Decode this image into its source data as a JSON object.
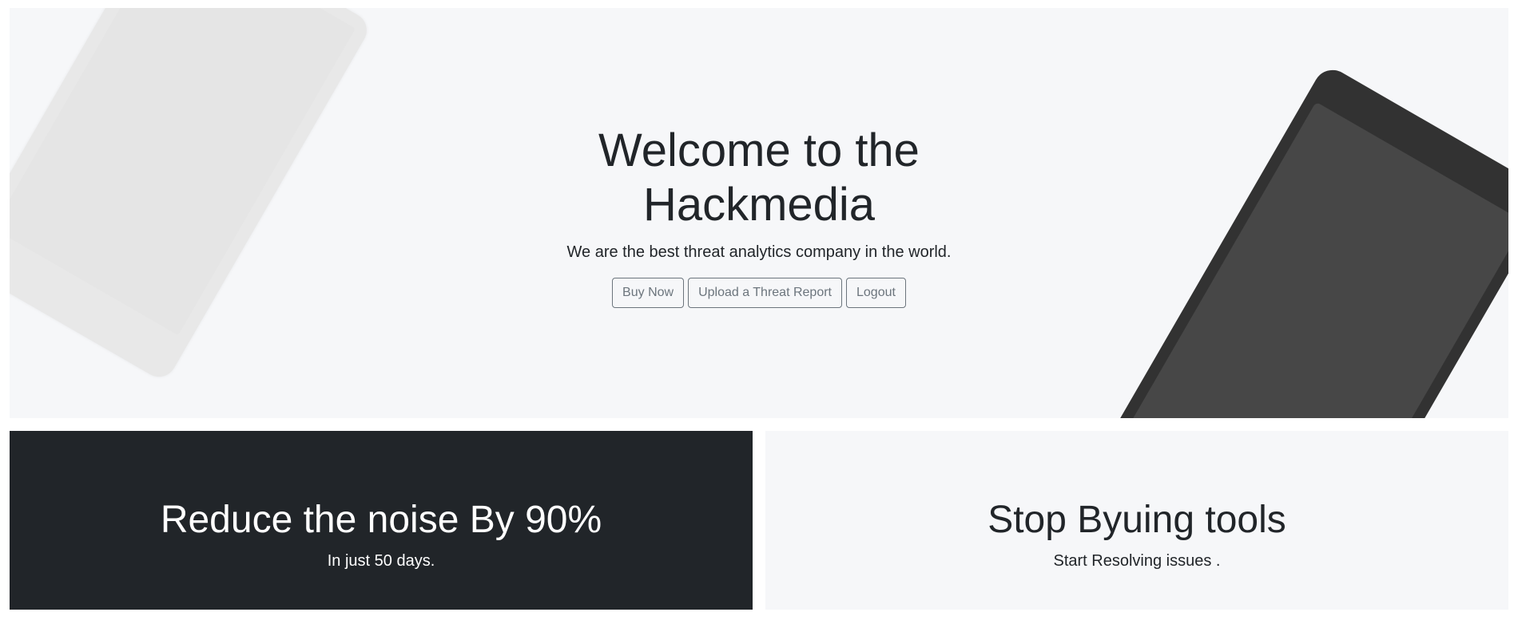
{
  "hero": {
    "title": "Welcome to the Hackmedia",
    "subtitle": "We are the best threat analytics company in the world.",
    "buttons": {
      "buy_now": "Buy Now",
      "upload": "Upload a Threat Report",
      "logout": "Logout"
    }
  },
  "panels": [
    {
      "title": "Reduce the noise By 90%",
      "subtitle": "In just 50 days."
    },
    {
      "title": "Stop Byuing tools",
      "subtitle": "Start Resolving issues ."
    }
  ],
  "colors": {
    "hero_background": "#f6f7f9",
    "dark_panel": "#212529",
    "button_outline": "#6c757d",
    "device_dark": "#323232",
    "device_light": "#e8e8e8"
  }
}
